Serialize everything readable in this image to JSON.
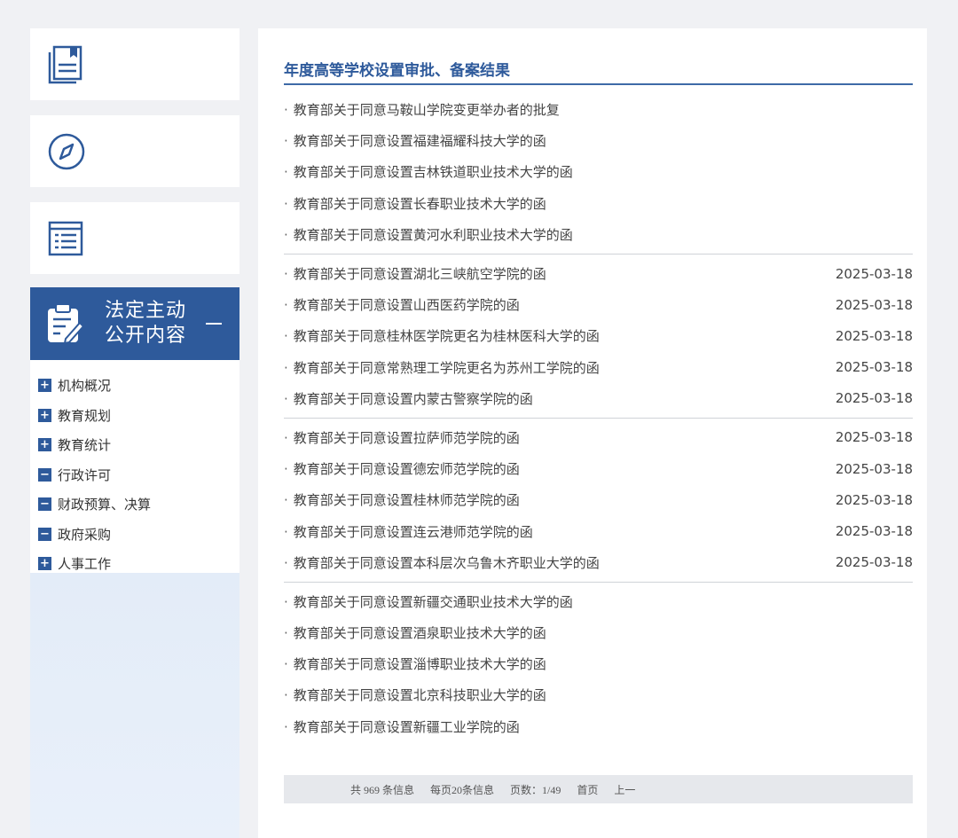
{
  "sidebar": {
    "icons": [
      "book-icon",
      "compass-icon",
      "newspaper-icon"
    ],
    "active": {
      "icon": "clipboard-edit-icon",
      "line1": "法定主动",
      "line2": "公开内容",
      "toggle": "—"
    },
    "categories": [
      {
        "label": "机构概况",
        "sign": "+"
      },
      {
        "label": "教育规划",
        "sign": "+"
      },
      {
        "label": "教育统计",
        "sign": "+"
      },
      {
        "label": "行政许可",
        "sign": "−"
      },
      {
        "label": "财政预算、决算",
        "sign": "−"
      },
      {
        "label": "政府采购",
        "sign": "−"
      },
      {
        "label": "人事工作",
        "sign": "+"
      }
    ]
  },
  "main": {
    "title": "年度高等学校设置审批、备案结果",
    "items": [
      {
        "text": "教育部关于同意马鞍山学院变更举办者的批复",
        "date": "",
        "blurred": true
      },
      {
        "text": "教育部关于同意设置福建福耀科技大学的函",
        "date": "",
        "blurred": true
      },
      {
        "text": "教育部关于同意设置吉林铁道职业技术大学的函",
        "date": "",
        "blurred": true
      },
      {
        "text": "教育部关于同意设置长春职业技术大学的函",
        "date": "",
        "blurred": true
      },
      {
        "text": "教育部关于同意设置黄河水利职业技术大学的函",
        "date": "",
        "blurred": true
      },
      {
        "text": "教育部关于同意设置湖北三峡航空学院的函",
        "date": "2025-03-18",
        "blurred": false
      },
      {
        "text": "教育部关于同意设置山西医药学院的函",
        "date": "2025-03-18",
        "blurred": false
      },
      {
        "text": "教育部关于同意桂林医学院更名为桂林医科大学的函",
        "date": "2025-03-18",
        "blurred": false
      },
      {
        "text": "教育部关于同意常熟理工学院更名为苏州工学院的函",
        "date": "2025-03-18",
        "blurred": false
      },
      {
        "text": "教育部关于同意设置内蒙古警察学院的函",
        "date": "2025-03-18",
        "blurred": false
      },
      {
        "text": "教育部关于同意设置拉萨师范学院的函",
        "date": "2025-03-18",
        "blurred": false
      },
      {
        "text": "教育部关于同意设置德宏师范学院的函",
        "date": "2025-03-18",
        "blurred": false
      },
      {
        "text": "教育部关于同意设置桂林师范学院的函",
        "date": "2025-03-18",
        "blurred": false
      },
      {
        "text": "教育部关于同意设置连云港师范学院的函",
        "date": "2025-03-18",
        "blurred": false
      },
      {
        "text": "教育部关于同意设置本科层次乌鲁木齐职业大学的函",
        "date": "2025-03-18",
        "blurred": false
      },
      {
        "text": "教育部关于同意设置新疆交通职业技术大学的函",
        "date": "",
        "blurred": true
      },
      {
        "text": "教育部关于同意设置酒泉职业技术大学的函",
        "date": "",
        "blurred": true
      },
      {
        "text": "教育部关于同意设置淄博职业技术大学的函",
        "date": "",
        "blurred": true
      },
      {
        "text": "教育部关于同意设置北京科技职业大学的函",
        "date": "",
        "blurred": true
      },
      {
        "text": "教育部关于同意设置新疆工业学院的函",
        "date": "",
        "blurred": true
      }
    ]
  },
  "pager": {
    "total": "共 969 条信息",
    "per_page": "每页20条信息",
    "pages": "页数：1/49",
    "first": "首页",
    "prev": "上一"
  },
  "colors": {
    "accent": "#2e5a9b"
  }
}
